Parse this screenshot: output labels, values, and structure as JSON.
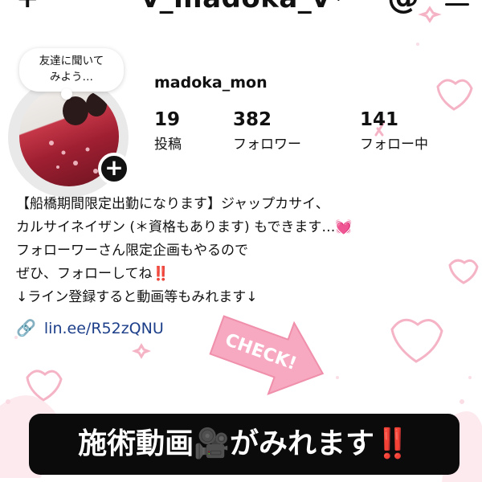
{
  "topbar": {
    "plus_icon": "plus-icon",
    "handle": "v_madoka_v",
    "chevron_icon": "chevron-down-icon",
    "threads_icon": "threads-icon",
    "menu_icon": "hamburger-menu-icon"
  },
  "note": {
    "line1": "友達に聞いて",
    "line2": "みよう…"
  },
  "profile": {
    "username": "madoka_mon",
    "stats": [
      {
        "value": "19",
        "label": "投稿"
      },
      {
        "value": "382",
        "label": "フォロワー"
      },
      {
        "value": "141",
        "label": "フォロー中"
      }
    ]
  },
  "bio": {
    "line1": "【船橋期間限定出勤になります】ジャップカサイ、",
    "line2": "カルサイネイザン (＊資格もあります) もできます…💓",
    "line3": "フォローワーさん限定企画もやるので",
    "line4": "ぜひ、フォローしてね‼️",
    "line5": "↓ライン登録すると動画等もみれます↓"
  },
  "link": {
    "url": "lin.ee/R52zQNU"
  },
  "stamp": {
    "text": "CHECK!"
  },
  "banner": {
    "main": "施術動画🎥がみれます",
    "tail": "‼️"
  },
  "colors": {
    "accent_pink": "#f5a6bd",
    "banner_bg": "#0b0b0b",
    "link": "#1d3f8a"
  }
}
